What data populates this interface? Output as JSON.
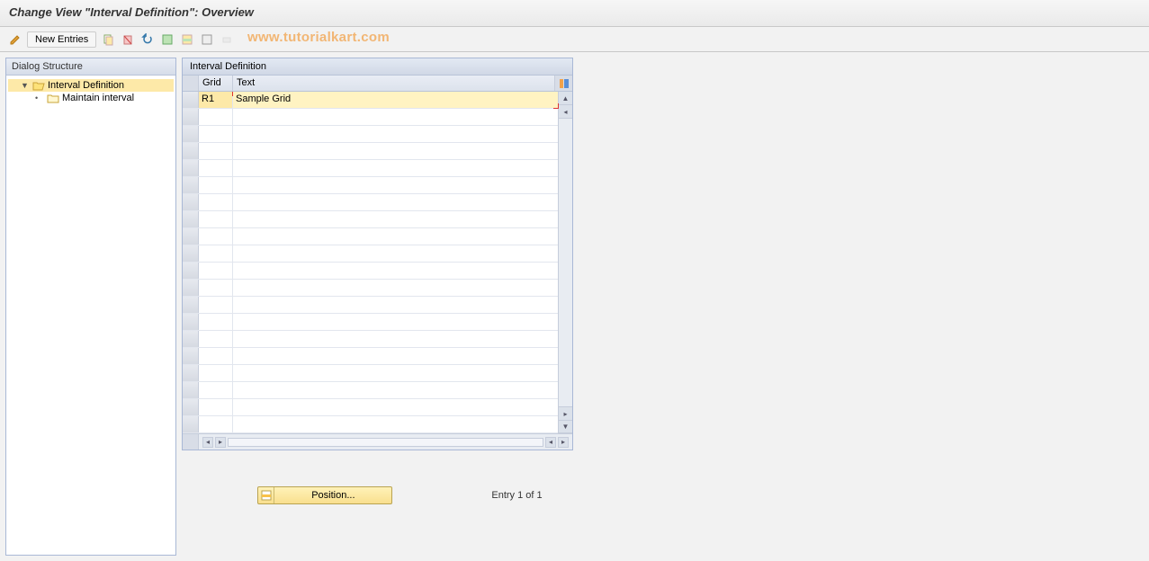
{
  "title": "Change View \"Interval Definition\": Overview",
  "toolbar": {
    "new_entries_label": "New Entries"
  },
  "watermark": "www.tutorialkart.com",
  "tree": {
    "header": "Dialog Structure",
    "root": "Interval Definition",
    "child": "Maintain interval"
  },
  "grid": {
    "title": "Interval Definition",
    "col_grid": "Grid",
    "col_text": "Text",
    "rows": [
      {
        "grid": "R1",
        "text": "Sample Grid"
      }
    ]
  },
  "footer": {
    "position_label": "Position...",
    "entry_text": "Entry 1 of 1"
  }
}
